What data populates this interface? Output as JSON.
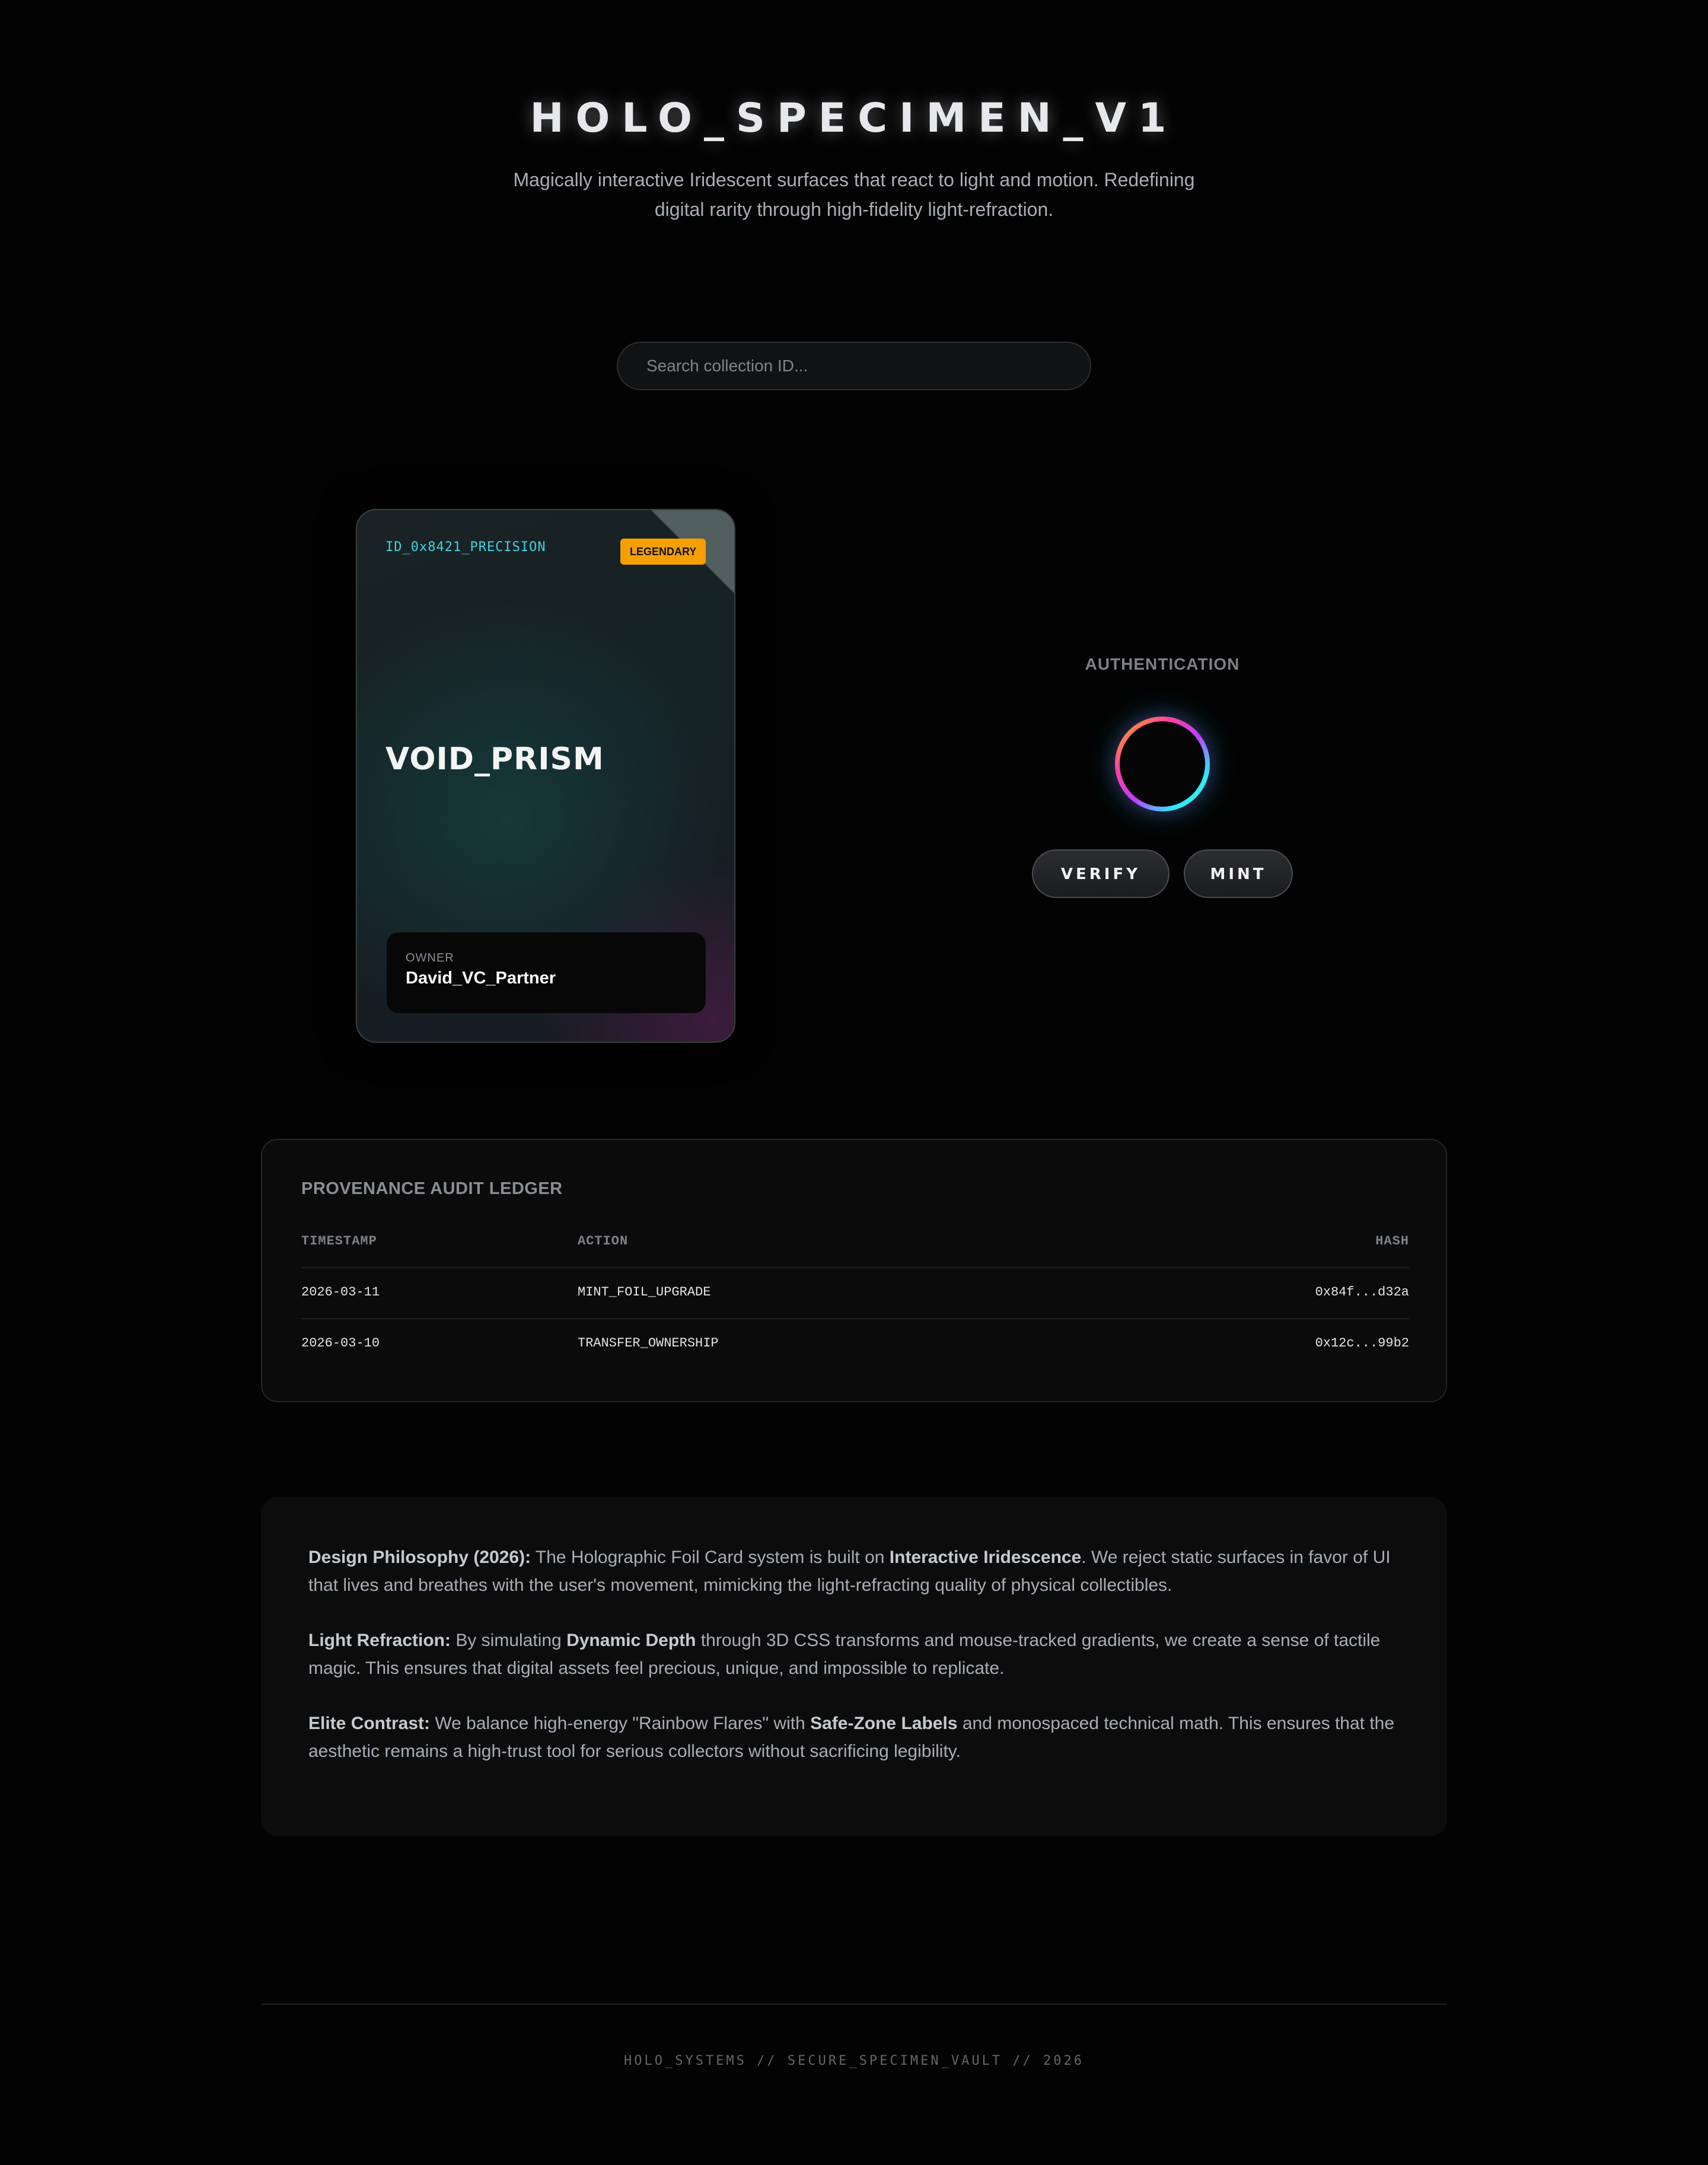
{
  "header": {
    "title": "HOLO_SPECIMEN_V1",
    "subtitle": "Magically interactive Iridescent surfaces that react to light and motion. Redefining digital rarity through high-fidelity light-refraction."
  },
  "search": {
    "placeholder": "Search collection ID...",
    "value": ""
  },
  "card": {
    "id": "ID_0x8421_PRECISION",
    "rarity": "LEGENDARY",
    "name": "VOID_PRISM",
    "owner_label": "OWNER",
    "owner": "David_VC_Partner",
    "colors": {
      "id_text": "#3fd3e0",
      "rarity_badge": "#f5a000"
    }
  },
  "auth": {
    "label": "AUTHENTICATION",
    "indicator_icon": "iridescent-ring-icon",
    "verify_label": "VERIFY",
    "mint_label": "MINT"
  },
  "ledger": {
    "title": "PROVENANCE AUDIT LEDGER",
    "columns": [
      "TIMESTAMP",
      "ACTION",
      "HASH"
    ],
    "rows": [
      {
        "timestamp": "2026-03-11",
        "action": "MINT_FOIL_UPGRADE",
        "hash": "0x84f...d32a"
      },
      {
        "timestamp": "2026-03-10",
        "action": "TRANSFER_OWNERSHIP",
        "hash": "0x12c...99b2"
      }
    ]
  },
  "philosophy": {
    "p1": {
      "lead": "Design Philosophy (2026):",
      "t1": " The Holographic Foil Card system is built on ",
      "b1": "Interactive Iridescence",
      "t2": ". We reject static surfaces in favor of UI that lives and breathes with the user's movement, mimicking the light-refracting quality of physical collectibles."
    },
    "p2": {
      "lead": "Light Refraction:",
      "t1": " By simulating ",
      "b1": "Dynamic Depth",
      "t2": " through 3D CSS transforms and mouse-tracked gradients, we create a sense of tactile magic. This ensures that digital assets feel precious, unique, and impossible to replicate."
    },
    "p3": {
      "lead": "Elite Contrast:",
      "t1": " We balance high-energy \"Rainbow Flares\" with ",
      "b1": "Safe-Zone Labels",
      "t2": " and monospaced technical math. This ensures that the aesthetic remains a high-trust tool for serious collectors without sacrificing legibility."
    }
  },
  "footer": {
    "text": "HOLO_SYSTEMS // SECURE_SPECIMEN_VAULT // 2026"
  }
}
